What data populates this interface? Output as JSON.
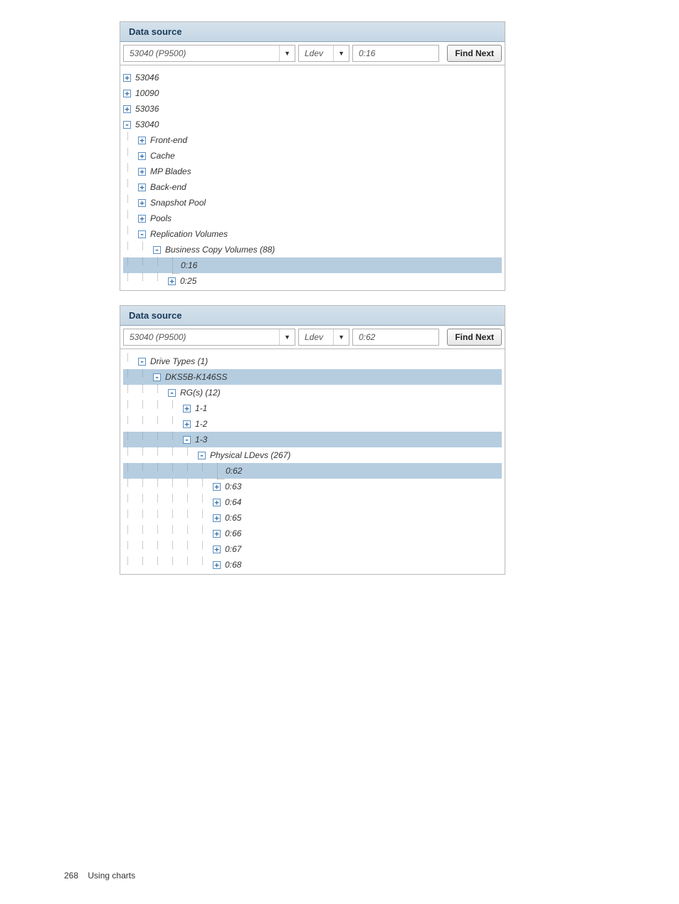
{
  "panel1": {
    "title": "Data source",
    "combo1": "53040 (P9500)",
    "combo2": "Ldev",
    "combo3": "0:16",
    "find": "Find Next",
    "tree": [
      {
        "depth": 0,
        "toggle": "+",
        "label": "53046"
      },
      {
        "depth": 0,
        "toggle": "+",
        "label": "10090"
      },
      {
        "depth": 0,
        "toggle": "+",
        "label": "53036"
      },
      {
        "depth": 0,
        "toggle": "-",
        "label": "53040"
      },
      {
        "depth": 1,
        "toggle": "+",
        "label": "Front-end"
      },
      {
        "depth": 1,
        "toggle": "+",
        "label": "Cache"
      },
      {
        "depth": 1,
        "toggle": "+",
        "label": "MP Blades"
      },
      {
        "depth": 1,
        "toggle": "+",
        "label": "Back-end"
      },
      {
        "depth": 1,
        "toggle": "+",
        "label": "Snapshot Pool"
      },
      {
        "depth": 1,
        "toggle": "+",
        "label": "Pools"
      },
      {
        "depth": 1,
        "toggle": "-",
        "label": "Replication Volumes"
      },
      {
        "depth": 2,
        "toggle": "-",
        "label": "Business Copy Volumes (88)"
      },
      {
        "depth": 3,
        "toggle": "",
        "label": "0:16",
        "selected": true,
        "end": true
      },
      {
        "depth": 3,
        "toggle": "+",
        "label": "0:25"
      }
    ]
  },
  "panel2": {
    "title": "Data source",
    "combo1": "53040 (P9500)",
    "combo2": "Ldev",
    "combo3": "0:62",
    "find": "Find Next",
    "tree": [
      {
        "depth": 1,
        "toggle": "-",
        "label": "Drive Types (1)"
      },
      {
        "depth": 2,
        "toggle": "-",
        "label": "DKS5B-K146SS",
        "selected": true
      },
      {
        "depth": 3,
        "toggle": "-",
        "label": "RG(s) (12)"
      },
      {
        "depth": 4,
        "toggle": "+",
        "label": "1-1"
      },
      {
        "depth": 4,
        "toggle": "+",
        "label": "1-2"
      },
      {
        "depth": 4,
        "toggle": "-",
        "label": "1-3",
        "selected": true
      },
      {
        "depth": 5,
        "toggle": "-",
        "label": "Physical LDevs (267)"
      },
      {
        "depth": 6,
        "toggle": "",
        "label": "0:62",
        "selected": true,
        "end": true
      },
      {
        "depth": 6,
        "toggle": "+",
        "label": "0:63"
      },
      {
        "depth": 6,
        "toggle": "+",
        "label": "0:64"
      },
      {
        "depth": 6,
        "toggle": "+",
        "label": "0:65"
      },
      {
        "depth": 6,
        "toggle": "+",
        "label": "0:66"
      },
      {
        "depth": 6,
        "toggle": "+",
        "label": "0:67"
      },
      {
        "depth": 6,
        "toggle": "+",
        "label": "0:68"
      }
    ]
  },
  "footer": {
    "pagenum": "268",
    "section": "Using charts"
  }
}
